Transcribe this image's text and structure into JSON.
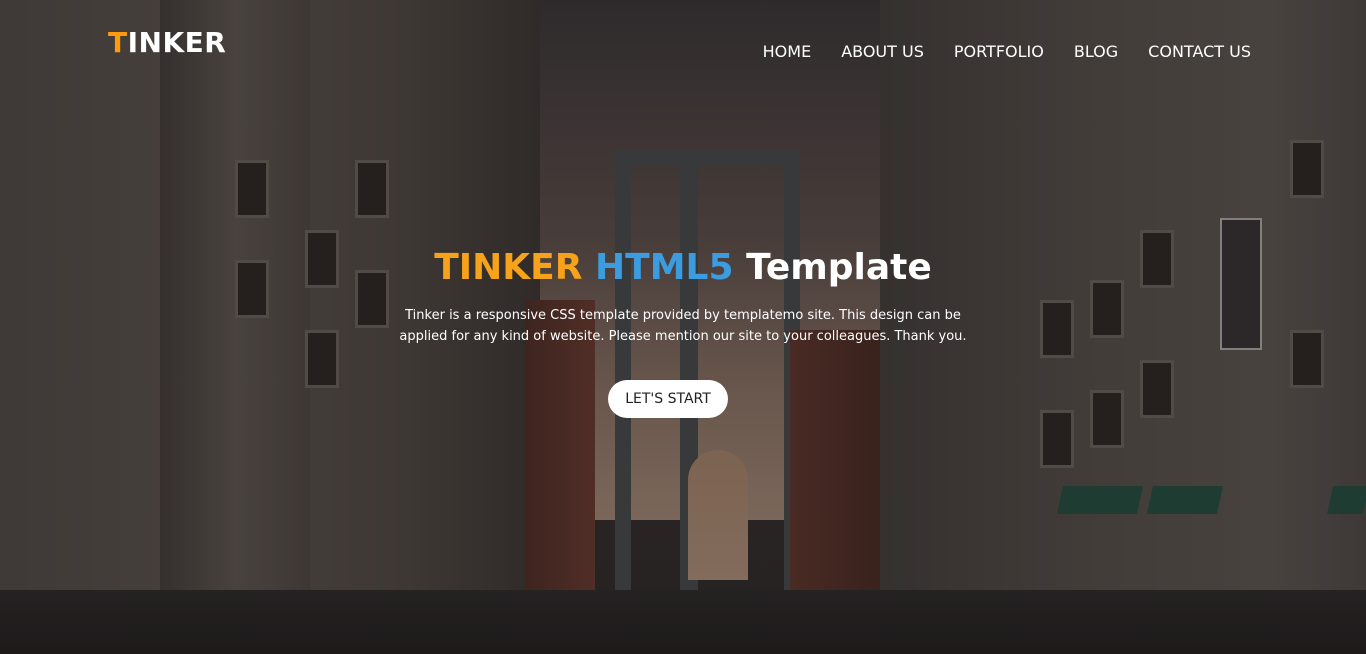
{
  "brand": {
    "logo_first": "T",
    "logo_rest": "INKER",
    "accent_color": "#ff9a0e"
  },
  "nav": {
    "items": [
      {
        "label": "HOME"
      },
      {
        "label": "ABOUT US"
      },
      {
        "label": "PORTFOLIO"
      },
      {
        "label": "BLOG"
      },
      {
        "label": "CONTACT US"
      }
    ]
  },
  "hero": {
    "title_part1": "TINKER",
    "title_part2": "HTML5",
    "title_part3": "Template",
    "title_part1_color": "#f7a21b",
    "title_part2_color": "#3c9ce0",
    "description": "Tinker is a responsive CSS template provided by templatemo site. This design can be applied for any kind of website. Please mention our site to your colleagues. Thank you.",
    "cta_label": "LET'S START"
  }
}
